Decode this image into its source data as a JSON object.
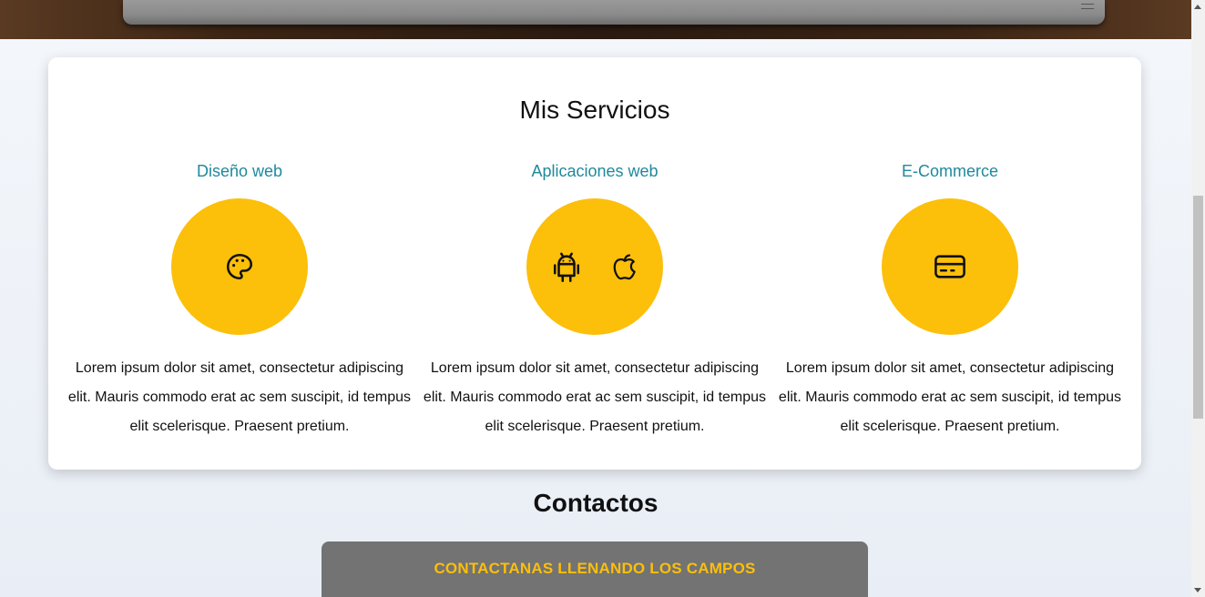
{
  "services_section": {
    "title": "Mis Servicios",
    "items": [
      {
        "title": "Diseño web",
        "icons": [
          "palette-icon"
        ],
        "description": "Lorem ipsum dolor sit amet, consectetur adipiscing elit. Mauris commodo erat ac sem suscipit, id tempus elit scelerisque. Praesent pretium."
      },
      {
        "title": "Aplicaciones web",
        "icons": [
          "android-icon",
          "apple-icon"
        ],
        "description": "Lorem ipsum dolor sit amet, consectetur adipiscing elit. Mauris commodo erat ac sem suscipit, id tempus elit scelerisque. Praesent pretium."
      },
      {
        "title": "E-Commerce",
        "icons": [
          "credit-card-icon"
        ],
        "description": "Lorem ipsum dolor sit amet, consectetur adipiscing elit. Mauris commodo erat ac sem suscipit, id tempus elit scelerisque. Praesent pretium."
      }
    ]
  },
  "contact_section": {
    "title": "Contactos",
    "form_title": "CONTACTANAS LLENANDO LOS CAMPOS"
  },
  "colors": {
    "accent_yellow": "#fcbf0a",
    "service_title_teal": "#1e8a9c",
    "contact_box_gray": "#737373"
  }
}
